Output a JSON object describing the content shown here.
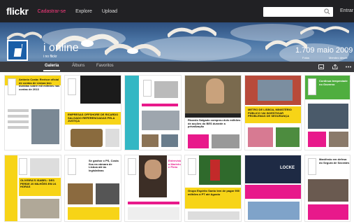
{
  "topbar": {
    "logo": "flickr",
    "links": [
      "Cadastrar-se",
      "Explore",
      "Upload"
    ],
    "signin": "Entrar",
    "search_placeholder": ""
  },
  "profile": {
    "name": "i online",
    "handle": "i no flickr",
    "photos_count": "1.709",
    "photos_label": "Fotos",
    "joined": "maio 2009",
    "joined_label": "Membro desde"
  },
  "tabs": [
    "Galeria",
    "Álbuns",
    "Favoritos"
  ],
  "thumbnails_row1": [
    {
      "headline": "António Costa: Revisor oficial de contas de Lisboa tem dúvidas sobre mil milhões nas contas de 2013",
      "accent": "#f7d417"
    },
    {
      "headline": "EMPRESAS OFFSHORE DE RICARDO SALGADO REFERENCIADAS PELA JUSTIÇA",
      "accent": "#e8198b"
    },
    {
      "headline": "",
      "accent": "#33b7c4"
    },
    {
      "headline": "Ricardo Salgado comprou dois milhões de acções do BES durante a privatização",
      "accent": "#222222"
    },
    {
      "headline": "METRO DE LISBOA, MINISTÉRIO PÚBLICO VAI INVESTIGAR PROBLEMAS DE SEGURANÇA",
      "accent": "#f7d417"
    },
    {
      "headline": "Continua tempestade no Governo",
      "accent": "#4fae3f"
    }
  ],
  "thumbnails_row2": [
    {
      "headline": "OLIVEIRA'S ISABEL: DES PERDE 20 MILHÕES EM 24 HORAS",
      "accent": "#f7d417"
    },
    {
      "headline": "Se ganhar o PS, Costa fica na câmara de Lisboa até às legislativas",
      "accent": "#f7d417"
    },
    {
      "headline": "Entrevista a Marinho e Pinto",
      "accent": "#e8198b"
    },
    {
      "headline": "Grupo Espírito Santo tem de pagar 900 milhões à PT até Agosto",
      "accent": "#f7d417"
    },
    {
      "headline": "LOCKE",
      "accent": "#e8198b"
    },
    {
      "headline": "Manifesto em defesa do Segura de Sócrates",
      "accent": "#e8198b"
    }
  ]
}
